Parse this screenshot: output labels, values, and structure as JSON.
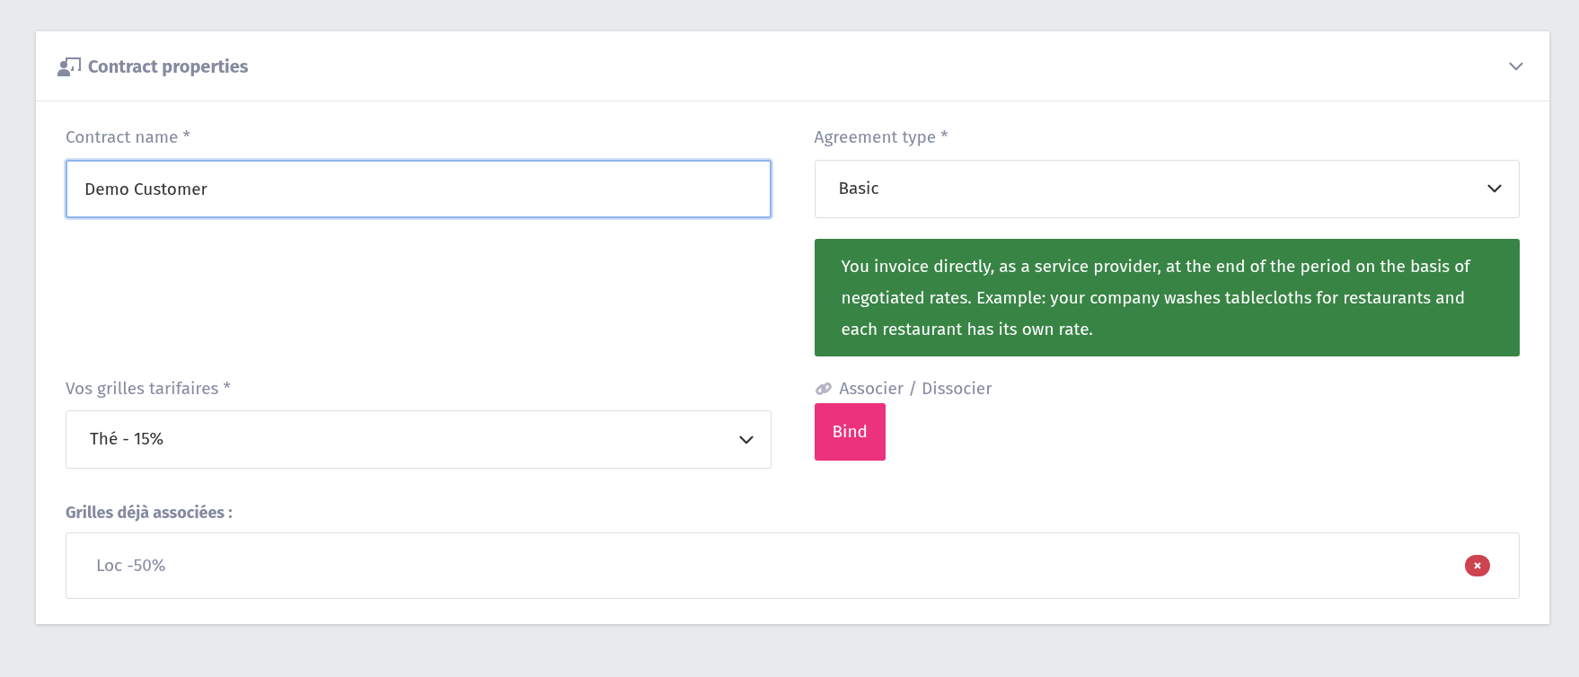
{
  "panel": {
    "title": "Contract properties",
    "expanded": true
  },
  "contract_name": {
    "label": "Contract name *",
    "value": "Demo Customer",
    "focused": true
  },
  "agreement_type": {
    "label": "Agreement type *",
    "value": "Basic",
    "info": "You invoice directly, as a service provider, at the end of the period on the basis of negotiated rates. Example: your company washes tablecloths for restaurants and each restaurant has its own rate."
  },
  "price_grids": {
    "label": "Vos grilles tarifaires *",
    "value": "Thé - 15%"
  },
  "bind": {
    "label": "Associer / Dissocier",
    "button": "Bind"
  },
  "associated": {
    "label": "Grilles déjà associées :",
    "items": [
      {
        "name": "Loc -50%"
      }
    ]
  }
}
